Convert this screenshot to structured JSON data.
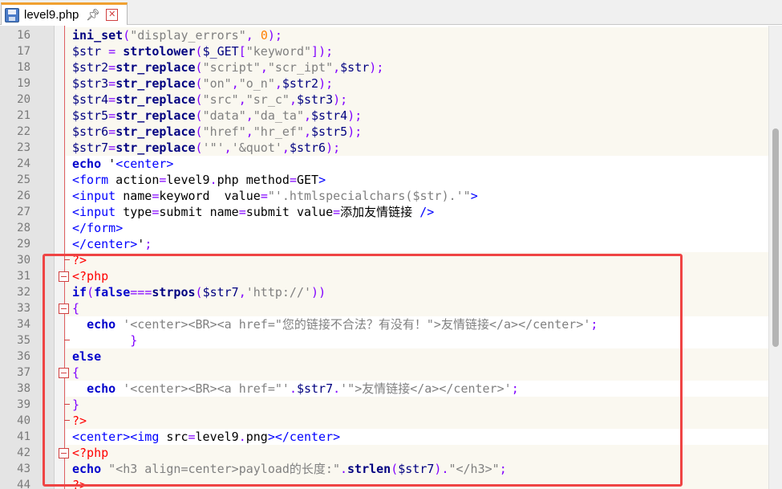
{
  "tab": {
    "filename": "level9.php",
    "icons": [
      "save-icon",
      "pin-icon",
      "close-icon"
    ]
  },
  "colors": {
    "highlight": "#ef4444",
    "keyword": "#0000cc",
    "php_tag": "#ff0000"
  },
  "lines": [
    {
      "n": "16",
      "code": "ini_set(\"display_errors\", 0);"
    },
    {
      "n": "17",
      "code": "$str = strtolower($_GET[\"keyword\"]);"
    },
    {
      "n": "18",
      "code": "$str2=str_replace(\"script\",\"scr_ipt\",$str);"
    },
    {
      "n": "19",
      "code": "$str3=str_replace(\"on\",\"o_n\",$str2);"
    },
    {
      "n": "20",
      "code": "$str4=str_replace(\"src\",\"sr_c\",$str3);"
    },
    {
      "n": "21",
      "code": "$str5=str_replace(\"data\",\"da_ta\",$str4);"
    },
    {
      "n": "22",
      "code": "$str6=str_replace(\"href\",\"hr_ef\",$str5);"
    },
    {
      "n": "23",
      "code": "$str7=str_replace('\"','&quot',$str6);"
    },
    {
      "n": "24",
      "code": "echo '<center>"
    },
    {
      "n": "25",
      "code": "<form action=level9.php method=GET>"
    },
    {
      "n": "26",
      "code": "<input name=keyword  value=\"'.htmlspecialchars($str).'\">"
    },
    {
      "n": "27",
      "code": "<input type=submit name=submit value=添加友情链接 />"
    },
    {
      "n": "28",
      "code": "</form>"
    },
    {
      "n": "29",
      "code": "</center>';"
    },
    {
      "n": "30",
      "code": "?>"
    },
    {
      "n": "31",
      "code": "<?php"
    },
    {
      "n": "32",
      "code": "if(false===strpos($str7,'http://'))"
    },
    {
      "n": "33",
      "code": "{"
    },
    {
      "n": "34",
      "code": "  echo '<center><BR><a href=\"您的链接不合法？有没有！\">友情链接</a></center>';"
    },
    {
      "n": "35",
      "code": "        }"
    },
    {
      "n": "36",
      "code": "else"
    },
    {
      "n": "37",
      "code": "{"
    },
    {
      "n": "38",
      "code": "  echo '<center><BR><a href=\"'.$str7.'\">友情链接</a></center>';"
    },
    {
      "n": "39",
      "code": "}"
    },
    {
      "n": "40",
      "code": "?>"
    },
    {
      "n": "41",
      "code": "<center><img src=level9.png></center>"
    },
    {
      "n": "42",
      "code": "<?php"
    },
    {
      "n": "43",
      "code": "echo \"<h3 align=center>payload的长度:\".strlen($str7).\"</h3>\";"
    },
    {
      "n": "44",
      "code": "?>"
    }
  ]
}
